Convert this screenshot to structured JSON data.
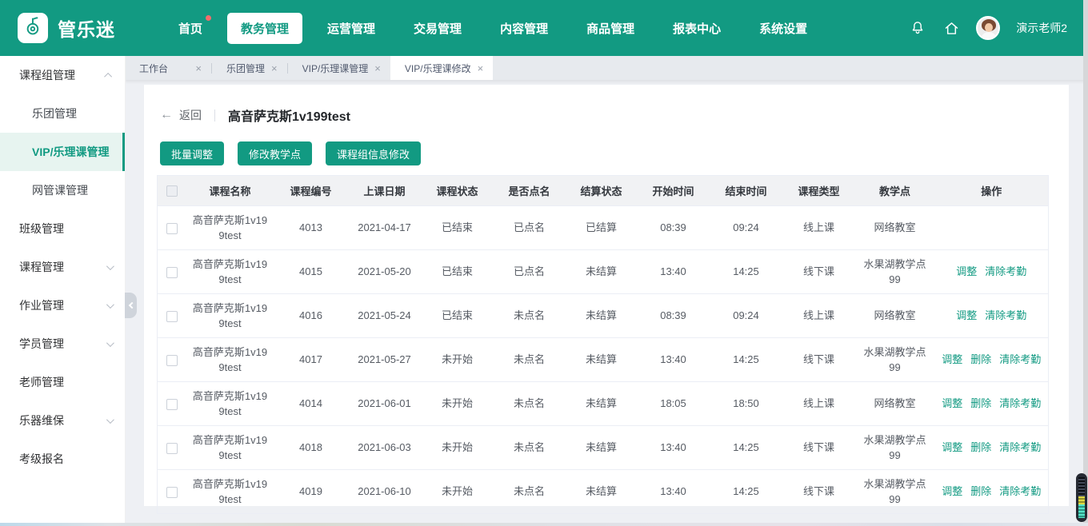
{
  "colors": {
    "accent": "#129a82",
    "badge_red": "#f56c6c"
  },
  "brand": {
    "name": "管乐迷",
    "logo_icon": "instrument-note-icon"
  },
  "topnav": {
    "items": [
      {
        "label": "首页",
        "badge": true
      },
      {
        "label": "教务管理",
        "active": true
      },
      {
        "label": "运营管理"
      },
      {
        "label": "交易管理"
      },
      {
        "label": "内容管理"
      },
      {
        "label": "商品管理"
      },
      {
        "label": "报表中心"
      },
      {
        "label": "系统设置"
      }
    ],
    "icons": [
      "bell-icon",
      "home-icon"
    ],
    "user": {
      "name": "演示老师2"
    }
  },
  "sidebar": {
    "items": [
      {
        "label": "课程组管理",
        "chevron": "up",
        "children": [
          {
            "label": "乐团管理"
          },
          {
            "label": "VIP/乐理课管理",
            "active": true
          },
          {
            "label": "网管课管理"
          }
        ]
      },
      {
        "label": "班级管理"
      },
      {
        "label": "课程管理",
        "chevron": "down"
      },
      {
        "label": "作业管理",
        "chevron": "down"
      },
      {
        "label": "学员管理",
        "chevron": "down"
      },
      {
        "label": "老师管理"
      },
      {
        "label": "乐器维保",
        "chevron": "down"
      },
      {
        "label": "考级报名"
      }
    ]
  },
  "tabs": [
    {
      "label": "工作台"
    },
    {
      "label": "乐团管理"
    },
    {
      "label": "VIP/乐理课管理"
    },
    {
      "label": "VIP/乐理课修改",
      "active": true
    }
  ],
  "page": {
    "back_label": "返回",
    "title": "高音萨克斯1v199test",
    "toolbar": [
      {
        "label": "批量调整"
      },
      {
        "label": "修改教学点"
      },
      {
        "label": "课程组信息修改"
      }
    ]
  },
  "table": {
    "columns": [
      "课程名称",
      "课程编号",
      "上课日期",
      "课程状态",
      "是否点名",
      "结算状态",
      "开始时间",
      "结束时间",
      "课程类型",
      "教学点",
      "操作"
    ],
    "rows": [
      {
        "name": "高音萨克斯1v199test",
        "code": "4013",
        "date": "2021-04-17",
        "status": "已结束",
        "rollcall": "已点名",
        "settlement": "已结算",
        "start": "08:39",
        "end": "09:24",
        "type": "线上课",
        "venue": "网络教室",
        "actions": []
      },
      {
        "name": "高音萨克斯1v199test",
        "code": "4015",
        "date": "2021-05-20",
        "status": "已结束",
        "rollcall": "已点名",
        "settlement": "未结算",
        "start": "13:40",
        "end": "14:25",
        "type": "线下课",
        "venue": "水果湖教学点99",
        "actions": [
          "调整",
          "清除考勤"
        ]
      },
      {
        "name": "高音萨克斯1v199test",
        "code": "4016",
        "date": "2021-05-24",
        "status": "已结束",
        "rollcall": "未点名",
        "settlement": "未结算",
        "start": "08:39",
        "end": "09:24",
        "type": "线上课",
        "venue": "网络教室",
        "actions": [
          "调整",
          "清除考勤"
        ]
      },
      {
        "name": "高音萨克斯1v199test",
        "code": "4017",
        "date": "2021-05-27",
        "status": "未开始",
        "rollcall": "未点名",
        "settlement": "未结算",
        "start": "13:40",
        "end": "14:25",
        "type": "线下课",
        "venue": "水果湖教学点99",
        "actions": [
          "调整",
          "删除",
          "清除考勤"
        ]
      },
      {
        "name": "高音萨克斯1v199test",
        "code": "4014",
        "date": "2021-06-01",
        "status": "未开始",
        "rollcall": "未点名",
        "settlement": "未结算",
        "start": "18:05",
        "end": "18:50",
        "type": "线上课",
        "venue": "网络教室",
        "actions": [
          "调整",
          "删除",
          "清除考勤"
        ]
      },
      {
        "name": "高音萨克斯1v199test",
        "code": "4018",
        "date": "2021-06-03",
        "status": "未开始",
        "rollcall": "未点名",
        "settlement": "未结算",
        "start": "13:40",
        "end": "14:25",
        "type": "线下课",
        "venue": "水果湖教学点99",
        "actions": [
          "调整",
          "删除",
          "清除考勤"
        ]
      },
      {
        "name": "高音萨克斯1v199test",
        "code": "4019",
        "date": "2021-06-10",
        "status": "未开始",
        "rollcall": "未点名",
        "settlement": "未结算",
        "start": "13:40",
        "end": "14:25",
        "type": "线下课",
        "venue": "水果湖教学点99",
        "actions": [
          "调整",
          "删除",
          "清除考勤"
        ]
      }
    ]
  }
}
